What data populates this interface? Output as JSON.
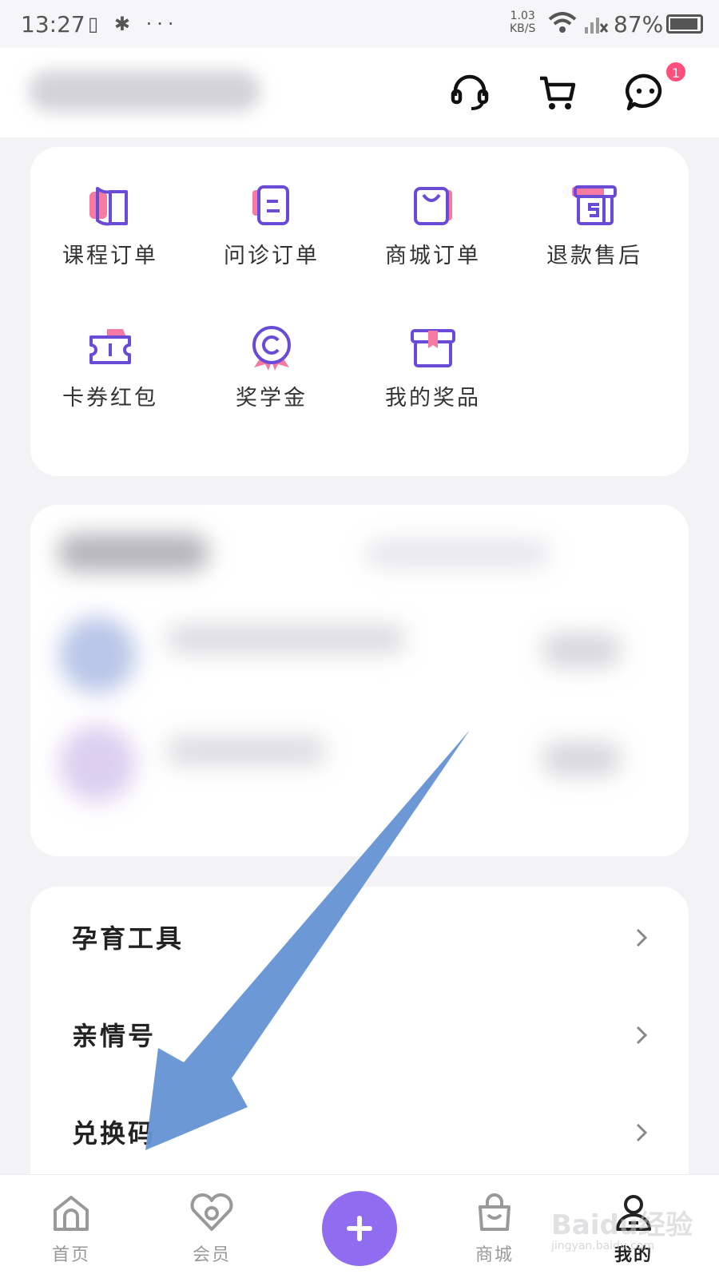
{
  "status_bar": {
    "time": "13:27",
    "network_speed": "1.03",
    "network_unit": "KB/S",
    "battery": "87%"
  },
  "header": {
    "icons": [
      "headset-icon",
      "cart-icon",
      "chat-icon"
    ],
    "message_badge": "1"
  },
  "orders": {
    "items": [
      {
        "label": "课程订单",
        "icon": "book-icon"
      },
      {
        "label": "问诊订单",
        "icon": "document-icon"
      },
      {
        "label": "商城订单",
        "icon": "shopping-bag-icon"
      },
      {
        "label": "退款售后",
        "icon": "refund-box-icon"
      },
      {
        "label": "卡券红包",
        "icon": "coupon-icon"
      },
      {
        "label": "奖学金",
        "icon": "medal-icon"
      },
      {
        "label": "我的奖品",
        "icon": "gift-box-icon"
      }
    ]
  },
  "menu": {
    "items": [
      {
        "label": "孕育工具"
      },
      {
        "label": "亲情号"
      },
      {
        "label": "兑换码"
      }
    ]
  },
  "bottom_nav": {
    "items": [
      {
        "label": "首页",
        "icon": "home-icon"
      },
      {
        "label": "会员",
        "icon": "heart-icon"
      },
      {
        "label": "商城",
        "icon": "shop-bag-icon"
      },
      {
        "label": "我的",
        "icon": "user-icon",
        "active": true
      }
    ],
    "center_button_icon": "plus-icon"
  },
  "watermark": {
    "text": "Baidu经验",
    "sub": "jingyan.baidu.com"
  },
  "colors": {
    "accent_purple": "#6a4bd6",
    "accent_pink": "#f77aa3",
    "fab_purple": "#8f6cf0",
    "annotation_arrow": "#6592d4"
  }
}
